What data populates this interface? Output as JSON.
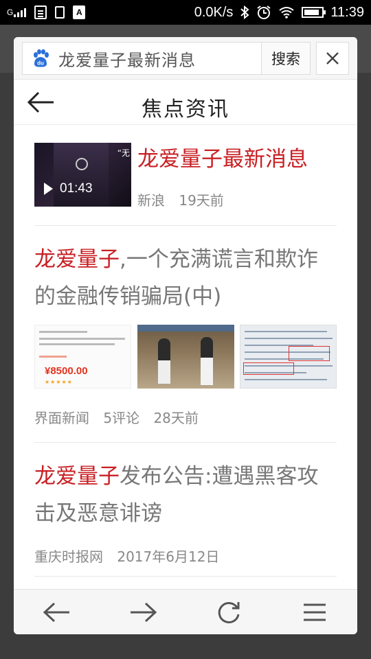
{
  "status_bar": {
    "signal_label": "G",
    "network_speed": "0.0K/s",
    "time": "11:39",
    "battery_level": 0.85,
    "icons": [
      "signal-icon",
      "document-icon",
      "clipboard-icon",
      "font-a-icon",
      "bluetooth-icon",
      "alarm-icon",
      "wifi-icon",
      "battery-icon"
    ]
  },
  "search": {
    "query": "龙爱量子最新消息",
    "submit_label": "搜索",
    "logo_text": "du"
  },
  "header": {
    "title": "焦点资讯"
  },
  "news": [
    {
      "headline": "龙爱量子最新消息",
      "video_duration": "01:43",
      "source": "新浪",
      "time": "19天前"
    },
    {
      "headline_highlight": "龙爱量子",
      "headline_rest": ",一个充满谎言和欺诈的金融传销骗局(中)",
      "thumb_price": "¥8500.00",
      "source": "界面新闻",
      "comments": "5评论",
      "time": "28天前"
    },
    {
      "headline_highlight": "龙爱量子",
      "headline_rest": "发布公告:遭遇黑客攻击及恶意诽谤",
      "source": "重庆时报网",
      "time": "2017年6月12日"
    }
  ],
  "colors": {
    "highlight": "#c82024",
    "baidu_blue": "#2b70d8",
    "meta_gray": "#888888"
  }
}
